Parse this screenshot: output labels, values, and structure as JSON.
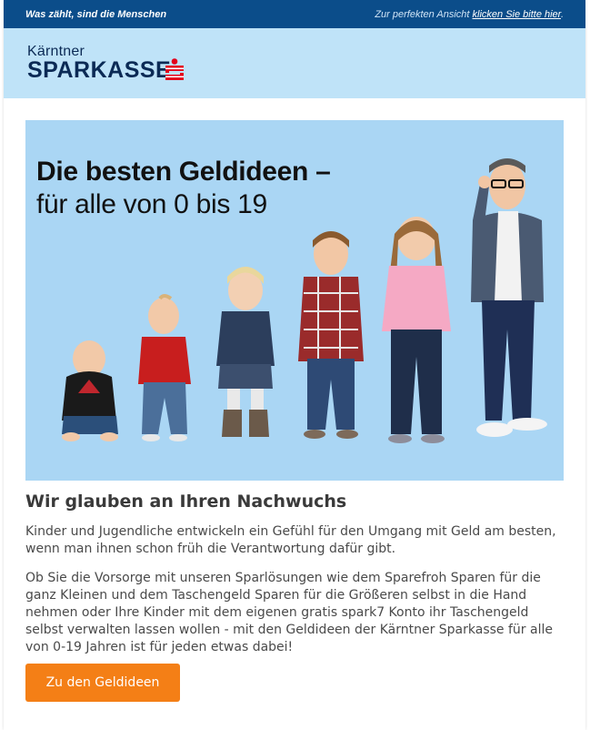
{
  "topbar": {
    "tagline": "Was zählt, sind die Menschen",
    "view_prefix": "Zur perfekten Ansicht ",
    "view_link": "klicken Sie bitte hier",
    "view_suffix": "."
  },
  "logo": {
    "line1": "Kärntner",
    "line2": "SPARKASSE",
    "icon": "sparkasse-s-icon",
    "brand_color": "#e2001a"
  },
  "hero": {
    "headline": "Die besten Geldideen –",
    "subline": "für alle von 0 bis 19",
    "background": "#aad6f4",
    "image_description_icon": "children-lineup-image"
  },
  "article": {
    "heading": "Wir glauben an Ihren Nachwuchs",
    "paragraph1": "Kinder und Jugendliche entwickeln ein Gefühl für den Umgang mit Geld am besten, wenn man ihnen schon früh die Verantwortung dafür gibt.",
    "paragraph2": "Ob Sie die Vorsorge mit unseren Sparlösungen wie dem Sparefroh Sparen für die ganz Kleinen und dem Taschengeld Sparen für die Größeren selbst in die Hand nehmen oder Ihre Kinder mit dem eigenen gratis spark7 Konto ihr Taschengeld selbst verwalten lassen wollen - mit den Geldideen der Kärntner Sparkasse für alle von 0-19 Jahren ist für jeden etwas dabei!"
  },
  "cta": {
    "label": "Zu den Geldideen",
    "color": "#f47f16"
  },
  "colors": {
    "topbar": "#0b4d8a",
    "header": "#bfe3f8"
  }
}
